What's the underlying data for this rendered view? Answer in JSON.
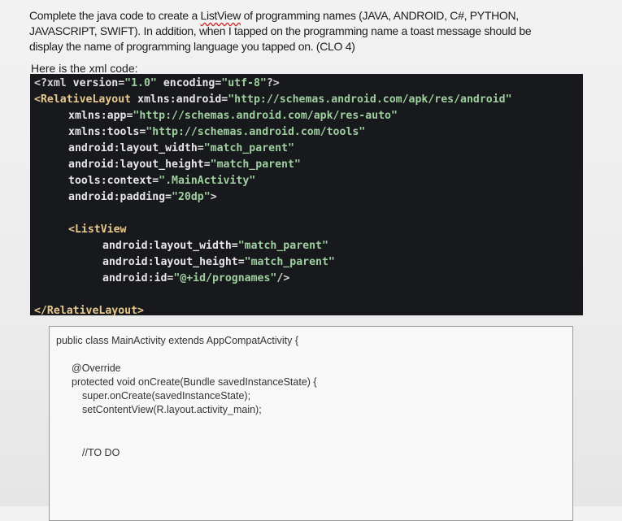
{
  "question": {
    "lines": [
      [
        "Complete the java code to create a ",
        "ListView",
        " of programming names (JAVA, ANDROID, C#, PYTHON,"
      ],
      [
        "JAVASCRIPT, SWIFT). In addition, when I tapped on the programming name a toast message should be"
      ],
      [
        "display the name of programming language you tapped on. (CLO 4)"
      ]
    ],
    "xml_label": "Here is the xml code:"
  },
  "xml_code": [
    {
      "indent": 0,
      "parts": [
        [
          "punc",
          "<?xml "
        ],
        [
          "attr",
          "version="
        ],
        [
          "val",
          "\"1.0\""
        ],
        [
          "attr",
          " encoding="
        ],
        [
          "val",
          "\"utf-8\""
        ],
        [
          "punc",
          "?>"
        ]
      ]
    },
    {
      "indent": 0,
      "parts": [
        [
          "tag",
          "<RelativeLayout "
        ],
        [
          "attr",
          "xmlns:android="
        ],
        [
          "val",
          "\"http://schemas.android.com/apk/res/android\""
        ]
      ]
    },
    {
      "indent": 4,
      "parts": [
        [
          "attr",
          "xmlns:app="
        ],
        [
          "val",
          "\"http://schemas.android.com/apk/res-auto\""
        ]
      ]
    },
    {
      "indent": 4,
      "parts": [
        [
          "attr",
          "xmlns:tools="
        ],
        [
          "val",
          "\"http://schemas.android.com/tools\""
        ]
      ]
    },
    {
      "indent": 4,
      "parts": [
        [
          "attr",
          "android:layout_width="
        ],
        [
          "val",
          "\"match_parent\""
        ]
      ]
    },
    {
      "indent": 4,
      "parts": [
        [
          "attr",
          "android:layout_height="
        ],
        [
          "val",
          "\"match_parent\""
        ]
      ]
    },
    {
      "indent": 4,
      "parts": [
        [
          "attr",
          "tools:context="
        ],
        [
          "val",
          "\".MainActivity\""
        ]
      ]
    },
    {
      "indent": 4,
      "parts": [
        [
          "attr",
          "android:padding="
        ],
        [
          "val",
          "\"20dp\""
        ],
        [
          "punc",
          ">"
        ]
      ]
    },
    {
      "indent": 0,
      "parts": []
    },
    {
      "indent": 4,
      "parts": [
        [
          "tag",
          "<ListView"
        ]
      ]
    },
    {
      "indent": 8,
      "parts": [
        [
          "attr",
          "android:layout_width="
        ],
        [
          "val",
          "\"match_parent\""
        ]
      ]
    },
    {
      "indent": 8,
      "parts": [
        [
          "attr",
          "android:layout_height="
        ],
        [
          "val",
          "\"match_parent\""
        ]
      ]
    },
    {
      "indent": 8,
      "parts": [
        [
          "attr",
          "android:id="
        ],
        [
          "val",
          "\"@+id/prognames\""
        ],
        [
          "punc",
          "/>"
        ]
      ]
    },
    {
      "indent": 0,
      "parts": []
    },
    {
      "indent": 0,
      "parts": [
        [
          "tag",
          "</RelativeLayout>"
        ]
      ]
    }
  ],
  "java_code": [
    "public class MainActivity extends AppCompatActivity {",
    "@Override",
    "protected void onCreate(Bundle savedInstanceState) {",
    "super.onCreate(savedInstanceState);",
    "setContentView(R.layout.activity_main);",
    "//TO DO"
  ]
}
